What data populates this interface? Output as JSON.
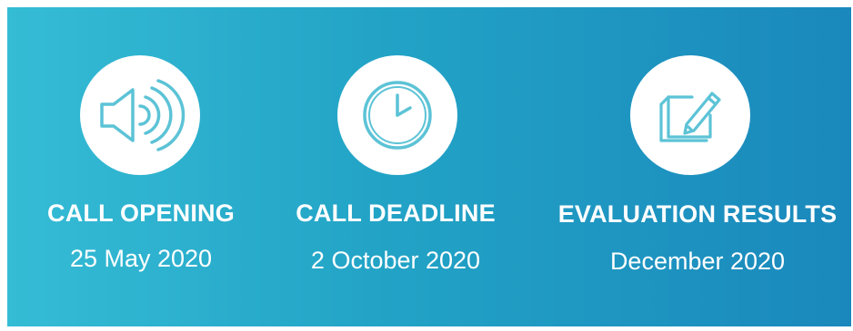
{
  "colors": {
    "gradient_start": "#35bcd5",
    "gradient_end": "#1a88bc",
    "icon_stroke": "#5cc3d6",
    "text": "#ffffff"
  },
  "milestones": [
    {
      "icon": "speaker-icon",
      "title": "CALL OPENING",
      "date": "25 May 2020"
    },
    {
      "icon": "clock-icon",
      "title": "CALL DEADLINE",
      "date": "2 October 2020"
    },
    {
      "icon": "document-pencil-icon",
      "title": "EVALUATION RESULTS",
      "date": "December 2020"
    }
  ]
}
